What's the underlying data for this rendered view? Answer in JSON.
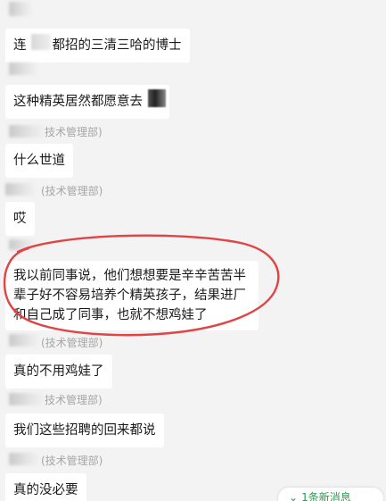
{
  "colors": {
    "background": "#f3f3f3",
    "bubble": "#ffffff",
    "sender_name": "#a6a6a6",
    "annotation_loop": "#e04444",
    "new_message_accent": "#2e9a4e"
  },
  "messages": [
    {
      "sender": "",
      "text": "连　　都招的三清三哈的博士"
    },
    {
      "sender": "",
      "text": "这种精英居然都愿意去"
    },
    {
      "sender": "技术管理部)",
      "text": "什么世道"
    },
    {
      "sender": "(技术管理部)",
      "text": "哎"
    },
    {
      "sender": "",
      "lines": [
        "我以前同事说，他们想想要是辛辛苦苦半",
        "辈子好不容易培养个精英孩子，结果进厂",
        "和自己成了同事，也就不想鸡娃了"
      ]
    },
    {
      "sender": "(技术管理部)",
      "text": "真的不用鸡娃了"
    },
    {
      "sender": "技术管理部)",
      "text": "我们这些招聘的回来都说"
    },
    {
      "sender": "(技术管理部)",
      "text": "真的没必要"
    }
  ],
  "new_message_indicator": {
    "icon": "chevron-down-icon",
    "label": "1条新消息"
  }
}
